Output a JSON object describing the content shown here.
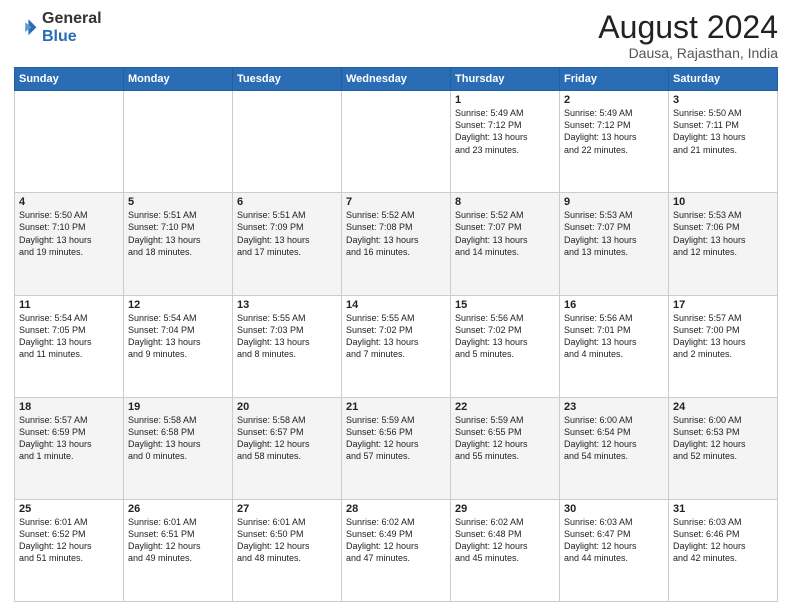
{
  "header": {
    "logo_general": "General",
    "logo_blue": "Blue",
    "month_year": "August 2024",
    "location": "Dausa, Rajasthan, India"
  },
  "days_of_week": [
    "Sunday",
    "Monday",
    "Tuesday",
    "Wednesday",
    "Thursday",
    "Friday",
    "Saturday"
  ],
  "weeks": [
    [
      {
        "day": "",
        "info": ""
      },
      {
        "day": "",
        "info": ""
      },
      {
        "day": "",
        "info": ""
      },
      {
        "day": "",
        "info": ""
      },
      {
        "day": "1",
        "info": "Sunrise: 5:49 AM\nSunset: 7:12 PM\nDaylight: 13 hours\nand 23 minutes."
      },
      {
        "day": "2",
        "info": "Sunrise: 5:49 AM\nSunset: 7:12 PM\nDaylight: 13 hours\nand 22 minutes."
      },
      {
        "day": "3",
        "info": "Sunrise: 5:50 AM\nSunset: 7:11 PM\nDaylight: 13 hours\nand 21 minutes."
      }
    ],
    [
      {
        "day": "4",
        "info": "Sunrise: 5:50 AM\nSunset: 7:10 PM\nDaylight: 13 hours\nand 19 minutes."
      },
      {
        "day": "5",
        "info": "Sunrise: 5:51 AM\nSunset: 7:10 PM\nDaylight: 13 hours\nand 18 minutes."
      },
      {
        "day": "6",
        "info": "Sunrise: 5:51 AM\nSunset: 7:09 PM\nDaylight: 13 hours\nand 17 minutes."
      },
      {
        "day": "7",
        "info": "Sunrise: 5:52 AM\nSunset: 7:08 PM\nDaylight: 13 hours\nand 16 minutes."
      },
      {
        "day": "8",
        "info": "Sunrise: 5:52 AM\nSunset: 7:07 PM\nDaylight: 13 hours\nand 14 minutes."
      },
      {
        "day": "9",
        "info": "Sunrise: 5:53 AM\nSunset: 7:07 PM\nDaylight: 13 hours\nand 13 minutes."
      },
      {
        "day": "10",
        "info": "Sunrise: 5:53 AM\nSunset: 7:06 PM\nDaylight: 13 hours\nand 12 minutes."
      }
    ],
    [
      {
        "day": "11",
        "info": "Sunrise: 5:54 AM\nSunset: 7:05 PM\nDaylight: 13 hours\nand 11 minutes."
      },
      {
        "day": "12",
        "info": "Sunrise: 5:54 AM\nSunset: 7:04 PM\nDaylight: 13 hours\nand 9 minutes."
      },
      {
        "day": "13",
        "info": "Sunrise: 5:55 AM\nSunset: 7:03 PM\nDaylight: 13 hours\nand 8 minutes."
      },
      {
        "day": "14",
        "info": "Sunrise: 5:55 AM\nSunset: 7:02 PM\nDaylight: 13 hours\nand 7 minutes."
      },
      {
        "day": "15",
        "info": "Sunrise: 5:56 AM\nSunset: 7:02 PM\nDaylight: 13 hours\nand 5 minutes."
      },
      {
        "day": "16",
        "info": "Sunrise: 5:56 AM\nSunset: 7:01 PM\nDaylight: 13 hours\nand 4 minutes."
      },
      {
        "day": "17",
        "info": "Sunrise: 5:57 AM\nSunset: 7:00 PM\nDaylight: 13 hours\nand 2 minutes."
      }
    ],
    [
      {
        "day": "18",
        "info": "Sunrise: 5:57 AM\nSunset: 6:59 PM\nDaylight: 13 hours\nand 1 minute."
      },
      {
        "day": "19",
        "info": "Sunrise: 5:58 AM\nSunset: 6:58 PM\nDaylight: 13 hours\nand 0 minutes."
      },
      {
        "day": "20",
        "info": "Sunrise: 5:58 AM\nSunset: 6:57 PM\nDaylight: 12 hours\nand 58 minutes."
      },
      {
        "day": "21",
        "info": "Sunrise: 5:59 AM\nSunset: 6:56 PM\nDaylight: 12 hours\nand 57 minutes."
      },
      {
        "day": "22",
        "info": "Sunrise: 5:59 AM\nSunset: 6:55 PM\nDaylight: 12 hours\nand 55 minutes."
      },
      {
        "day": "23",
        "info": "Sunrise: 6:00 AM\nSunset: 6:54 PM\nDaylight: 12 hours\nand 54 minutes."
      },
      {
        "day": "24",
        "info": "Sunrise: 6:00 AM\nSunset: 6:53 PM\nDaylight: 12 hours\nand 52 minutes."
      }
    ],
    [
      {
        "day": "25",
        "info": "Sunrise: 6:01 AM\nSunset: 6:52 PM\nDaylight: 12 hours\nand 51 minutes."
      },
      {
        "day": "26",
        "info": "Sunrise: 6:01 AM\nSunset: 6:51 PM\nDaylight: 12 hours\nand 49 minutes."
      },
      {
        "day": "27",
        "info": "Sunrise: 6:01 AM\nSunset: 6:50 PM\nDaylight: 12 hours\nand 48 minutes."
      },
      {
        "day": "28",
        "info": "Sunrise: 6:02 AM\nSunset: 6:49 PM\nDaylight: 12 hours\nand 47 minutes."
      },
      {
        "day": "29",
        "info": "Sunrise: 6:02 AM\nSunset: 6:48 PM\nDaylight: 12 hours\nand 45 minutes."
      },
      {
        "day": "30",
        "info": "Sunrise: 6:03 AM\nSunset: 6:47 PM\nDaylight: 12 hours\nand 44 minutes."
      },
      {
        "day": "31",
        "info": "Sunrise: 6:03 AM\nSunset: 6:46 PM\nDaylight: 12 hours\nand 42 minutes."
      }
    ]
  ]
}
